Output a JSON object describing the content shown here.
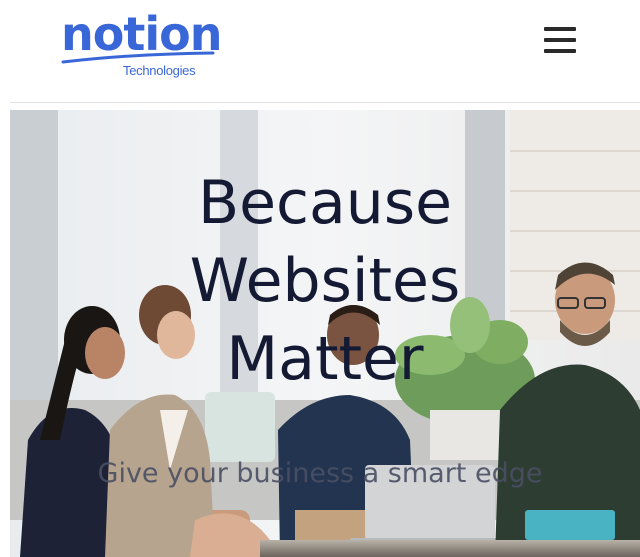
{
  "header": {
    "logo": {
      "word": "notion",
      "subtext": "Technologies"
    },
    "menu_icon": "hamburger-menu-icon"
  },
  "hero": {
    "title_lines": [
      "Because",
      "Websites",
      "Matter"
    ],
    "subtitle": "Give your business a smart edge",
    "image": "team-meeting-photo"
  },
  "colors": {
    "brand": "#3a67d8",
    "title": "#141a33",
    "subtitle": "#4a4f63"
  }
}
